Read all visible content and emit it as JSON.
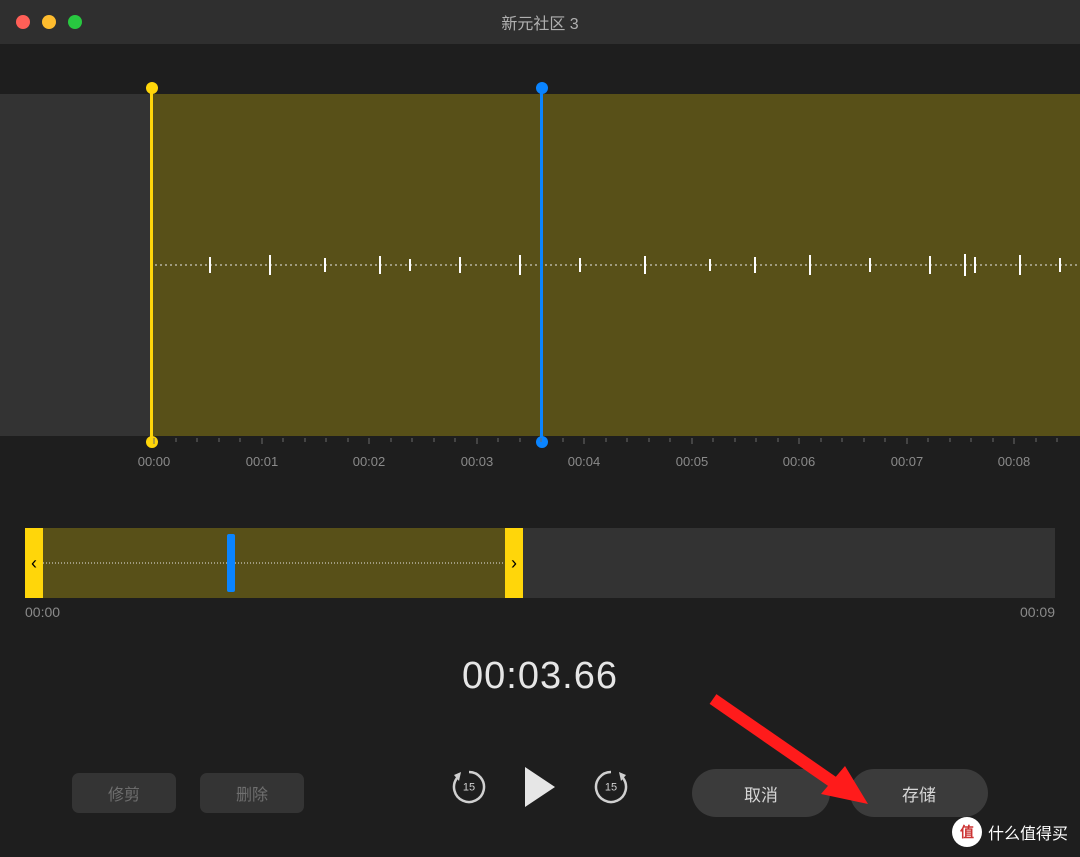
{
  "window": {
    "title": "新元社区 3"
  },
  "ruler": {
    "labels": [
      "00:00",
      "00:01",
      "00:02",
      "00:03",
      "00:04",
      "00:05",
      "00:06",
      "00:07",
      "00:08"
    ]
  },
  "overview": {
    "start": "00:00",
    "end": "00:09"
  },
  "time_display": "00:03.66",
  "buttons": {
    "trim": "修剪",
    "delete": "删除",
    "cancel": "取消",
    "save": "存储",
    "skip_back_seconds": "15",
    "skip_fwd_seconds": "15"
  },
  "watermark": {
    "badge": "值",
    "text": "什么值得买"
  },
  "colors": {
    "accent_yellow": "#ffd60a",
    "accent_blue": "#0a84ff",
    "selection_fill": "#585018",
    "bg_dark": "#1e1e1e",
    "annotation_red": "#ff1b1b"
  }
}
